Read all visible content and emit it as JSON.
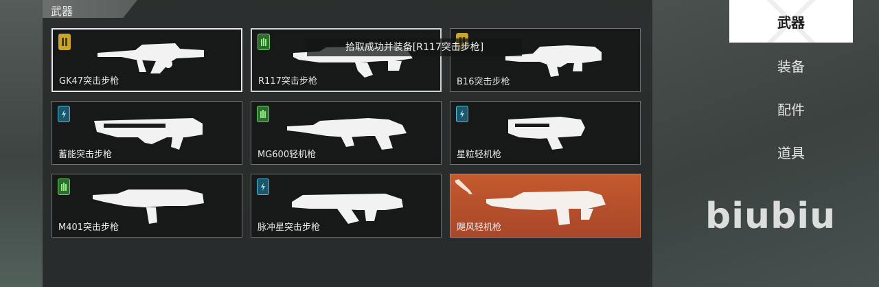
{
  "section_title": "武器",
  "tooltip": "拾取成功并装备[R117突击步枪]",
  "weapons": [
    {
      "name": "GK47突击步枪",
      "badge": "gold",
      "badge_icon": "magazine-icon",
      "state": "selected"
    },
    {
      "name": "R117突击步枪",
      "badge": "green",
      "badge_icon": "ammo-icon",
      "state": "equipped"
    },
    {
      "name": "B16突击步枪",
      "badge": "gold",
      "badge_icon": "magazine-icon",
      "state": "normal"
    },
    {
      "name": "蓄能突击步枪",
      "badge": "blue",
      "badge_icon": "energy-icon",
      "state": "normal"
    },
    {
      "name": "MG600轻机枪",
      "badge": "green",
      "badge_icon": "ammo-icon",
      "state": "normal"
    },
    {
      "name": "星粒轻机枪",
      "badge": "blue",
      "badge_icon": "energy-icon",
      "state": "normal"
    },
    {
      "name": "M401突击步枪",
      "badge": "green",
      "badge_icon": "ammo-icon",
      "state": "normal"
    },
    {
      "name": "脉冲星突击步枪",
      "badge": "blue",
      "badge_icon": "energy-icon",
      "state": "normal"
    },
    {
      "name": "飓风轻机枪",
      "badge": "none",
      "badge_icon": "rifle-icon",
      "state": "highlight"
    }
  ],
  "tabs": [
    {
      "label": "武器",
      "active": true
    },
    {
      "label": "装备",
      "active": false
    },
    {
      "label": "配件",
      "active": false
    },
    {
      "label": "道具",
      "active": false
    }
  ],
  "watermark": "biubiu",
  "colors": {
    "gold_badge": "#c9a52b",
    "green_badge": "#6fd16a",
    "blue_badge": "#4fbfe0",
    "highlight": "#c45a2e"
  }
}
